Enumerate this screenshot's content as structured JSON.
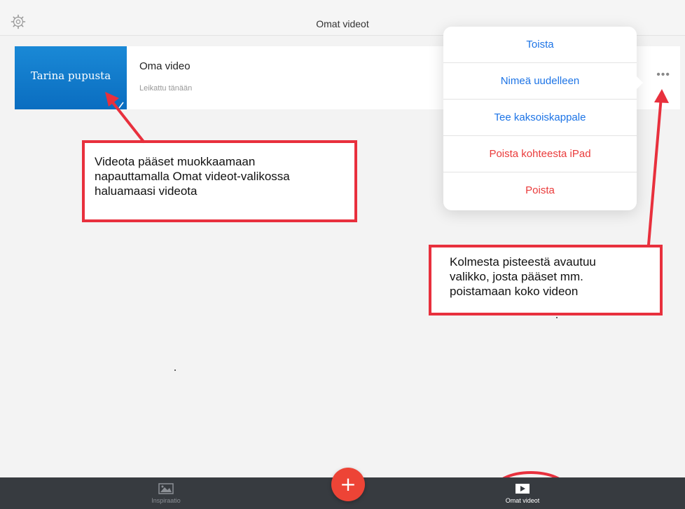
{
  "header": {
    "title": "Omat videot",
    "settings_icon": "gear-icon"
  },
  "video": {
    "thumbnail_title": "Tarina pupusta",
    "name": "Oma video",
    "subtitle": "Leikattu tänään",
    "more_icon": "ellipsis-icon",
    "thumbnail_color": "#0a7bd0"
  },
  "menu": {
    "items": [
      {
        "label": "Toista",
        "color": "#1d74e6"
      },
      {
        "label": "Nimeä uudelleen",
        "color": "#1d74e6"
      },
      {
        "label": "Tee kaksoiskappale",
        "color": "#1d74e6"
      },
      {
        "label": "Poista kohteesta iPad",
        "color": "#ea3a3a"
      },
      {
        "label": "Poista",
        "color": "#ea3a3a"
      }
    ]
  },
  "annotations": {
    "callout1_lines": [
      "Videota pääset muokkaamaan",
      "napauttamalla Omat videot-valikossa",
      "haluamaasi videota"
    ],
    "callout2_lines": [
      "Kolmesta pisteestä avautuu",
      "valikko, josta pääset mm.",
      "poistamaan koko videon"
    ],
    "accent_color": "#e8303d"
  },
  "bottom_bar": {
    "tabs": [
      {
        "label": "Inspiraatio",
        "icon": "image-icon"
      },
      {
        "label": "Omat videot",
        "icon": "play-icon"
      }
    ],
    "add_icon": "plus-icon",
    "add_color": "#ed4436"
  }
}
